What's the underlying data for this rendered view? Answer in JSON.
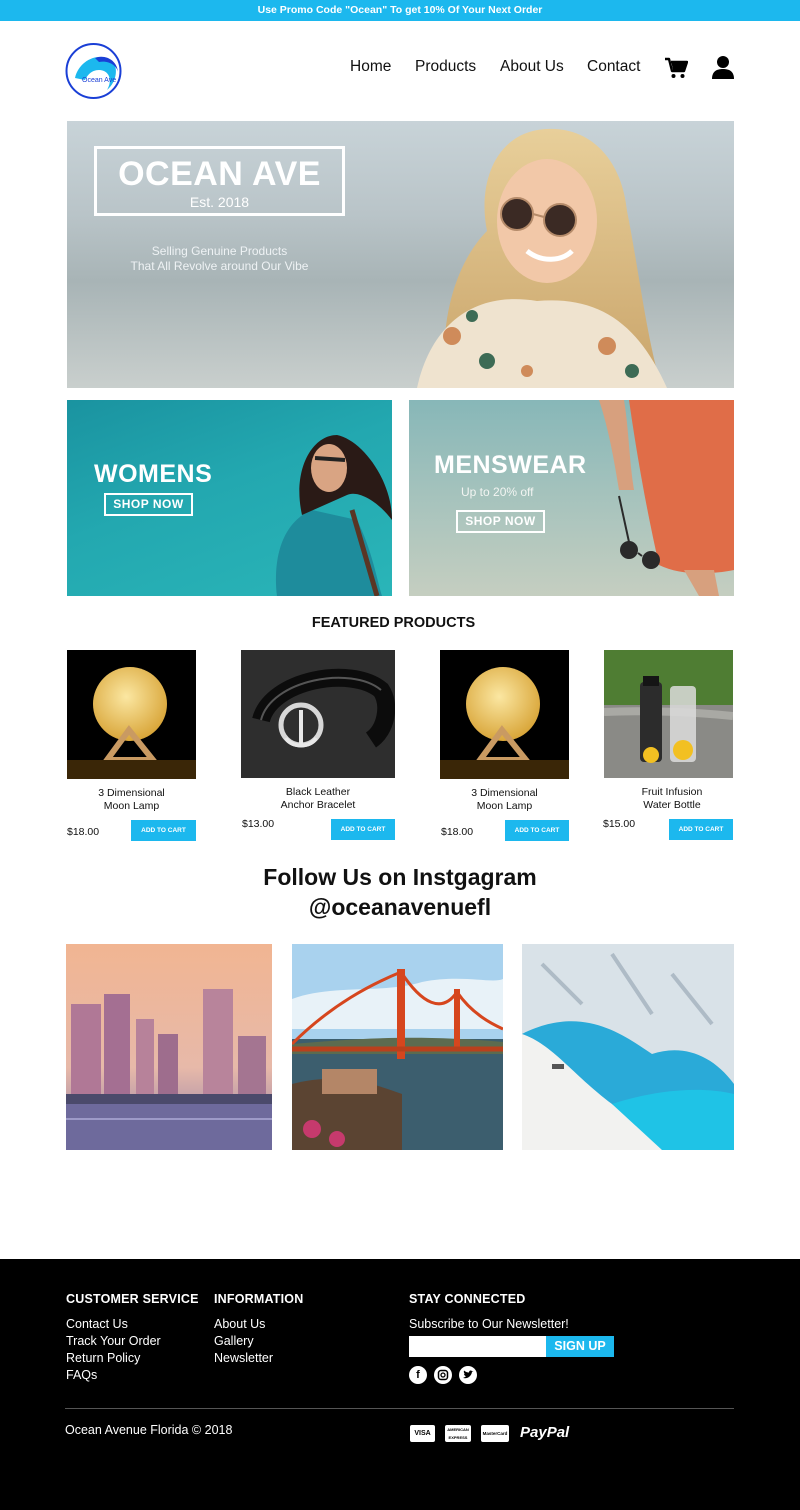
{
  "promo": {
    "text": "Use Promo Code \"Ocean\" To get 10% Of Your Next Order"
  },
  "brand": {
    "logo_text": "Ocean Ave",
    "accent": "#1cb8ee"
  },
  "nav": {
    "home": "Home",
    "products": "Products",
    "about": "About Us",
    "contact": "Contact",
    "cart_icon": "cart-icon",
    "user_icon": "user-icon"
  },
  "hero": {
    "title": "OCEAN AVE",
    "established": "Est. 2018",
    "tagline_line1": "Selling Genuine Products",
    "tagline_line2": "That All Revolve around Our Vibe"
  },
  "banners": {
    "womens": {
      "title": "WOMENS",
      "button": "SHOP NOW"
    },
    "menswear": {
      "title": "MENSWEAR",
      "subtitle": "Up to 20% off",
      "button": "SHOP NOW"
    }
  },
  "featured": {
    "title": "FEATURED PRODUCTS",
    "products": [
      {
        "name_line1": "3 Dimensional",
        "name_line2": "Moon Lamp",
        "price": "$18.00",
        "button": "ADD TO CART"
      },
      {
        "name_line1": "Black Leather",
        "name_line2": "Anchor Bracelet",
        "price": "$13.00",
        "button": "ADD TO CART"
      },
      {
        "name_line1": "3 Dimensional",
        "name_line2": "Moon Lamp",
        "price": "$18.00",
        "button": "ADD TO CART"
      },
      {
        "name_line1": "Fruit Infusion",
        "name_line2": "Water Bottle",
        "price": "$15.00",
        "button": "ADD TO CART"
      }
    ]
  },
  "instagram": {
    "title_line1": "Follow Us on Instgagram",
    "title_line2": "@oceanavenuefl"
  },
  "footer": {
    "customer_service": {
      "heading": "CUSTOMER SERVICE",
      "links": [
        "Contact Us",
        "Track Your Order",
        "Return Policy",
        "FAQs"
      ]
    },
    "information": {
      "heading": "INFORMATION",
      "links": [
        "About Us",
        "Gallery",
        "Newsletter"
      ]
    },
    "stay_connected": {
      "heading": "STAY CONNECTED",
      "subscribe_text": "Subscribe to Our Newsletter!",
      "signup_button": "SIGN UP",
      "email_value": "",
      "social_icons": [
        "facebook-icon",
        "instagram-icon",
        "twitter-icon"
      ]
    },
    "copyright": "Ocean Avenue Florida © 2018",
    "payments": {
      "visa": "VISA",
      "amex": "AMERICAN EXPRESS",
      "mastercard": "MasterCard",
      "paypal": "PayPal"
    }
  }
}
